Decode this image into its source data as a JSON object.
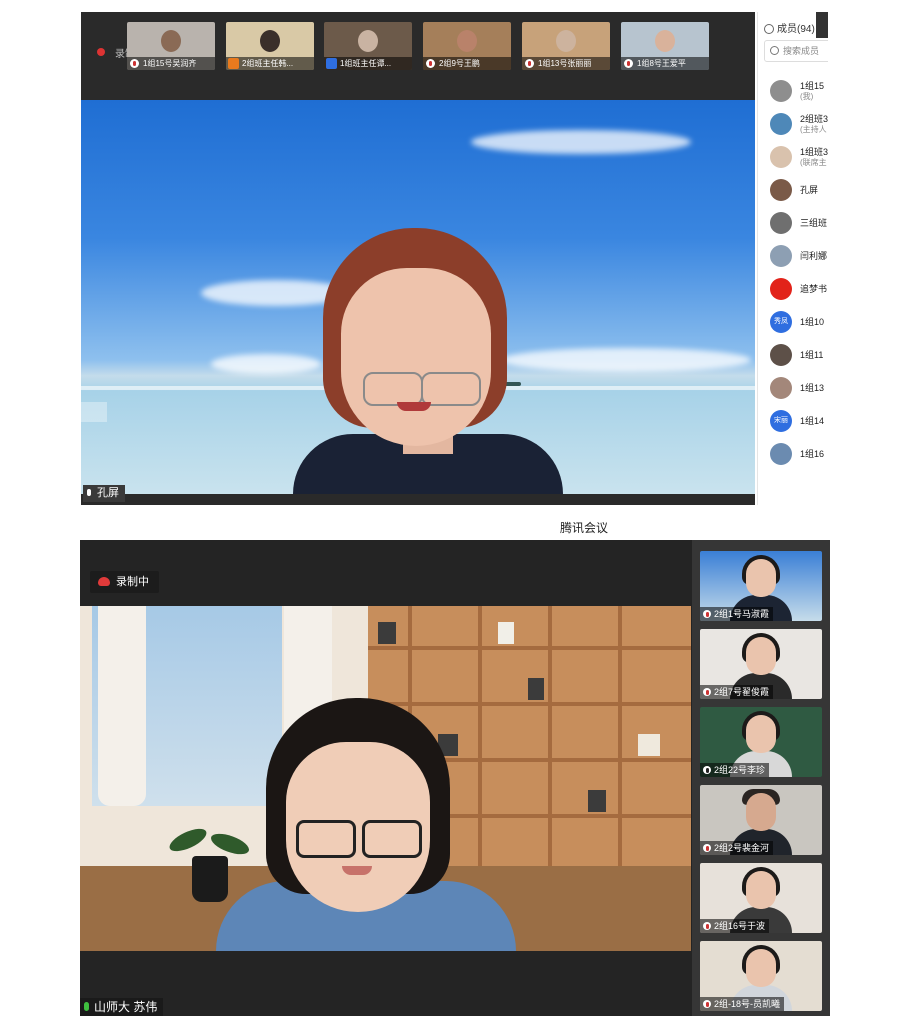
{
  "screenshot1": {
    "recording_label": "录制中",
    "thumbnails": [
      {
        "label": "1组15号吴润齐",
        "icon": "mic-muted-icon"
      },
      {
        "label": "2组班主任韩...",
        "icon": "user-icon"
      },
      {
        "label": "1组班主任谭...",
        "icon": "user-icon"
      },
      {
        "label": "2组9号王鹏",
        "icon": "mic-muted-icon"
      },
      {
        "label": "1组13号张丽丽",
        "icon": "mic-muted-icon"
      },
      {
        "label": "1组8号王爱平",
        "icon": "mic-muted-icon"
      }
    ],
    "speaker_name": "孔屏",
    "members_panel": {
      "title": "成员(94)",
      "search_placeholder": "搜索成员",
      "members": [
        {
          "name": "1组15",
          "sub": "(我)",
          "avatar": ""
        },
        {
          "name": "2组班3",
          "sub": "(主持人",
          "avatar": ""
        },
        {
          "name": "1组班3",
          "sub": "(联席主",
          "avatar": ""
        },
        {
          "name": "孔屏",
          "sub": "",
          "avatar": ""
        },
        {
          "name": "三组班",
          "sub": "",
          "avatar": ""
        },
        {
          "name": "闫利娜",
          "sub": "",
          "avatar": ""
        },
        {
          "name": "追梦书",
          "sub": "",
          "avatar": ""
        },
        {
          "name": "1组10",
          "sub": "",
          "avatar": "秀凤"
        },
        {
          "name": "1组11",
          "sub": "",
          "avatar": ""
        },
        {
          "name": "1组13",
          "sub": "",
          "avatar": ""
        },
        {
          "name": "1组14",
          "sub": "",
          "avatar": "宋丽"
        },
        {
          "name": "1组16",
          "sub": "",
          "avatar": ""
        }
      ]
    }
  },
  "caption": "腾讯会议",
  "screenshot2": {
    "recording_label": "录制中",
    "speaker_name": "山师大  苏伟",
    "participants": [
      {
        "label": "2组1号马淑霞",
        "mic": "muted"
      },
      {
        "label": "2组7号翟俊霞",
        "mic": "muted"
      },
      {
        "label": "2组22号李珍",
        "mic": "on"
      },
      {
        "label": "2组2号裴金河",
        "mic": "muted"
      },
      {
        "label": "2组16号于波",
        "mic": "muted"
      },
      {
        "label": "2组-18号-员凯曦",
        "mic": "muted"
      }
    ]
  },
  "colors": {
    "toolbar_dark": "#2a2a2a",
    "record_red": "#d33333",
    "mic_green": "#3fbf3f",
    "member_blue": "#2f6ee0"
  }
}
